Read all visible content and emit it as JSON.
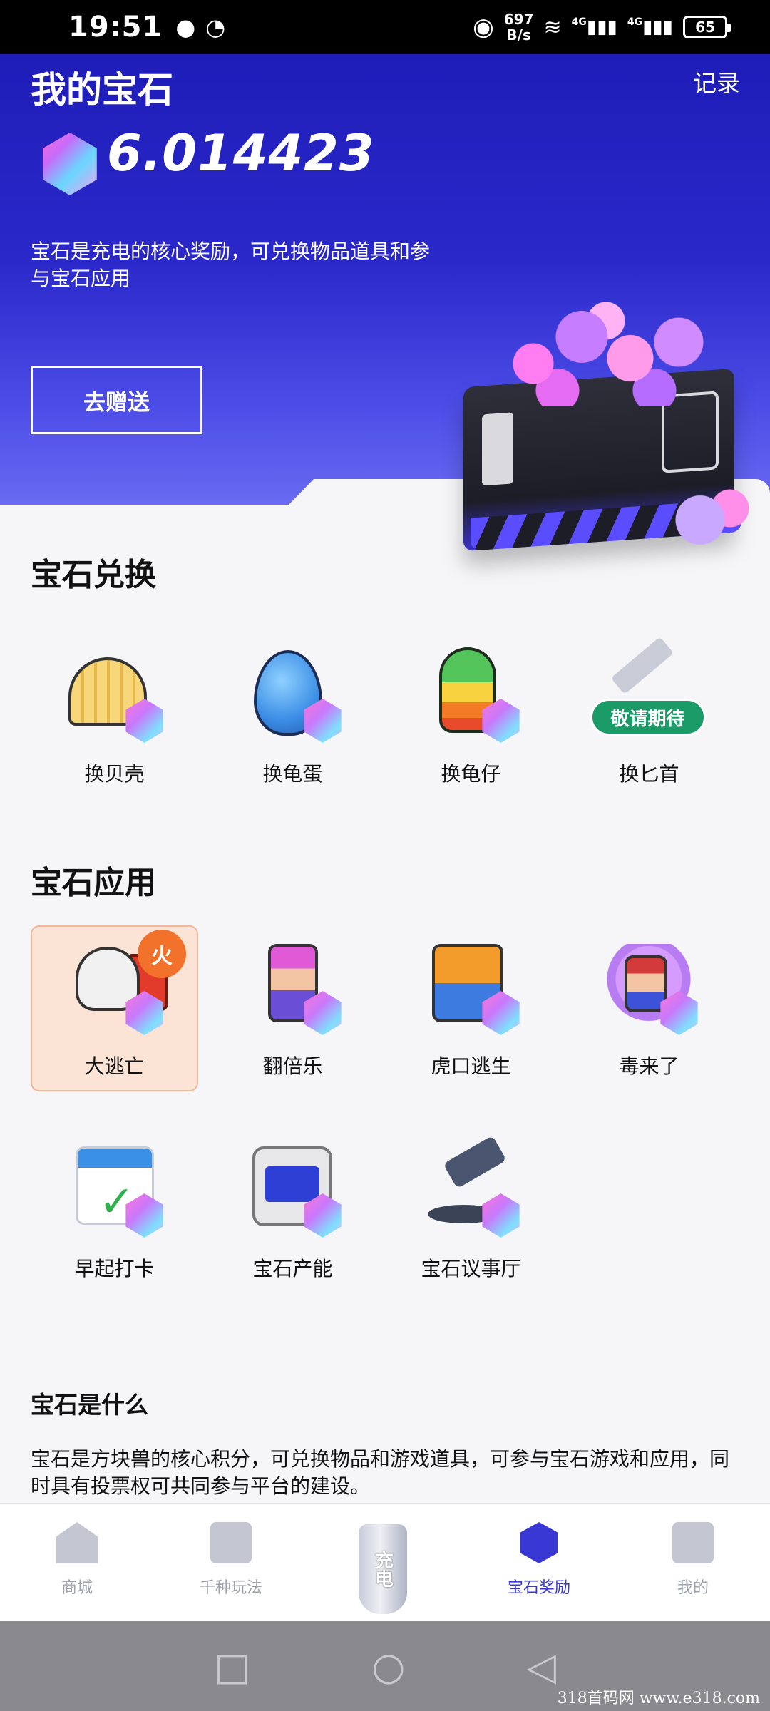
{
  "status_bar": {
    "time": "19:51",
    "net_speed_value": "697",
    "net_speed_unit": "B/s",
    "signal_1": "4G",
    "signal_2": "4G",
    "battery": "65"
  },
  "hero": {
    "title": "我的宝石",
    "record_link": "记录",
    "balance": "6.014423",
    "description": "宝石是充电的核心奖励，可兑换物品道具和参与宝石应用",
    "gift_button": "去赠送"
  },
  "exchange": {
    "title": "宝石兑换",
    "items": [
      {
        "label": "换贝壳"
      },
      {
        "label": "换龟蛋"
      },
      {
        "label": "换龟仔"
      },
      {
        "label": "换匕首",
        "badge": "敬请期待"
      }
    ]
  },
  "apps": {
    "title": "宝石应用",
    "items": [
      {
        "label": "大逃亡",
        "badge": "火"
      },
      {
        "label": "翻倍乐"
      },
      {
        "label": "虎口逃生"
      },
      {
        "label": "毒来了"
      },
      {
        "label": "早起打卡"
      },
      {
        "label": "宝石产能"
      },
      {
        "label": "宝石议事厅"
      }
    ]
  },
  "what_is": {
    "title": "宝石是什么",
    "text": "宝石是方块兽的核心积分，可兑换物品和游戏道具，可参与宝石游戏和应用，同时具有投票权可共同参与平台的建设。"
  },
  "bottom_nav": {
    "tabs": [
      {
        "label": "商城"
      },
      {
        "label": "千种玩法"
      },
      {
        "label": "宝石奖励",
        "active": true
      },
      {
        "label": "我的"
      }
    ],
    "charge_label": "充电"
  },
  "watermark": "318首码网  www.e318.com",
  "colors": {
    "hero_blue": "#2a28c9",
    "active_tab": "#3a38d4",
    "hot_orange": "#f2712b",
    "coming_green": "#1b9b68"
  }
}
